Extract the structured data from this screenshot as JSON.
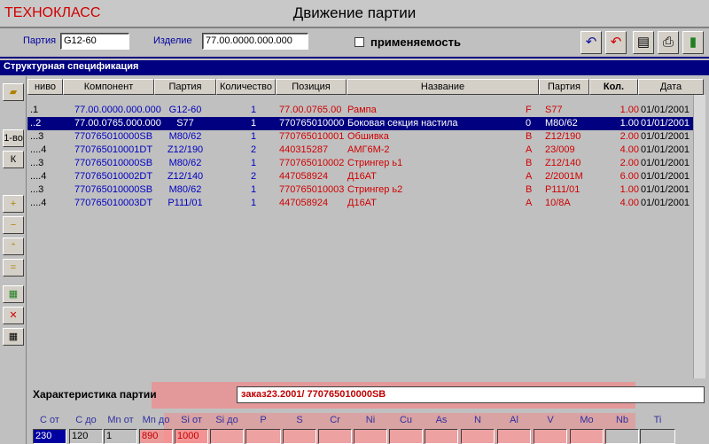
{
  "app": {
    "brand": "ТЕХНОКЛАСС",
    "title": "Движение партии"
  },
  "filters": {
    "party_label": "Партия",
    "party_value": "G12-60",
    "item_label": "Изделие",
    "item_value": "77.00.0000.000.000",
    "applicability_label": "применяемость"
  },
  "toolbar": [
    "undo-icon",
    "undo-red-icon",
    "document-icon",
    "printer-icon",
    "exit-door-icon"
  ],
  "section_title": "Структурная спецификация",
  "left_toolbar": {
    "b1": "1-во",
    "b2": "К",
    "icons": [
      "open-folder-icon",
      "add-icon",
      "remove-icon",
      "add-level-icon",
      "remove-level-icon",
      "new-doc-icon",
      "delete-doc-icon",
      "edit-doc-icon"
    ]
  },
  "grid": {
    "headers": [
      "ниво",
      "Компонент",
      "Партия",
      "Количество",
      "Позиция",
      "Название",
      "Партия",
      "Кол.",
      "Дата"
    ],
    "rows": [
      {
        "level": ".1",
        "component": "77.00.0000.000.000",
        "party": "G12-60",
        "qty": "1",
        "position": "77.00.0765.00",
        "name": "Рампа",
        "code": "F",
        "party2": "S77",
        "kol": "1.00",
        "date": "01/01/2001",
        "selected": false
      },
      {
        "level": "..2",
        "component": "77.00.0765.000.000",
        "party": "S77",
        "qty": "1",
        "position": "770765010000",
        "name": "Боковая секция настила",
        "code": "0",
        "party2": "M80/62",
        "kol": "1.00",
        "date": "01/01/2001",
        "selected": true
      },
      {
        "level": "...3",
        "component": "770765010000SB",
        "party": "M80/62",
        "qty": "1",
        "position": "770765010001",
        "name": "Обшивка",
        "code": "B",
        "party2": "Z12/190",
        "kol": "2.00",
        "date": "01/01/2001",
        "selected": false
      },
      {
        "level": "....4",
        "component": "770765010001DT",
        "party": "Z12/190",
        "qty": "2",
        "position": "440315287",
        "name": "АМГ6М-2",
        "code": "A",
        "party2": "23/009",
        "kol": "4.00",
        "date": "01/01/2001",
        "selected": false
      },
      {
        "level": "...3",
        "component": "770765010000SB",
        "party": "M80/62",
        "qty": "1",
        "position": "770765010002",
        "name": "Стрингер ь1",
        "code": "B",
        "party2": "Z12/140",
        "kol": "2.00",
        "date": "01/01/2001",
        "selected": false
      },
      {
        "level": "....4",
        "component": "770765010002DT",
        "party": "Z12/140",
        "qty": "2",
        "position": "447058924",
        "name": "Д16АТ",
        "code": "A",
        "party2": "2/2001M",
        "kol": "6.00",
        "date": "01/01/2001",
        "selected": false
      },
      {
        "level": "...3",
        "component": "770765010000SB",
        "party": "M80/62",
        "qty": "1",
        "position": "770765010003",
        "name": "Стрингер ь2",
        "code": "B",
        "party2": "P111/01",
        "kol": "1.00",
        "date": "01/01/2001",
        "selected": false
      },
      {
        "level": "....4",
        "component": "770765010003DT",
        "party": "P111/01",
        "qty": "1",
        "position": "447058924",
        "name": "Д16АТ",
        "code": "A",
        "party2": "10/8A",
        "kol": "4.00",
        "date": "01/01/2001",
        "selected": false
      }
    ]
  },
  "characteristics": {
    "label": "Характеристика партии",
    "value": "заказ23.2001/ 770765010000SB"
  },
  "composition": {
    "headers": [
      "C от",
      "C до",
      "Mn от",
      "Mn до",
      "Si от",
      "Si до",
      "P",
      "S",
      "Cr",
      "Ni",
      "Cu",
      "As",
      "N",
      "Al",
      "V",
      "Mo",
      "Nb",
      "Ti"
    ],
    "values": [
      "230",
      "120",
      "1",
      "890",
      "1000",
      "",
      "",
      "",
      "",
      "",
      "",
      "",
      "",
      "",
      "",
      "",
      "",
      ""
    ]
  }
}
